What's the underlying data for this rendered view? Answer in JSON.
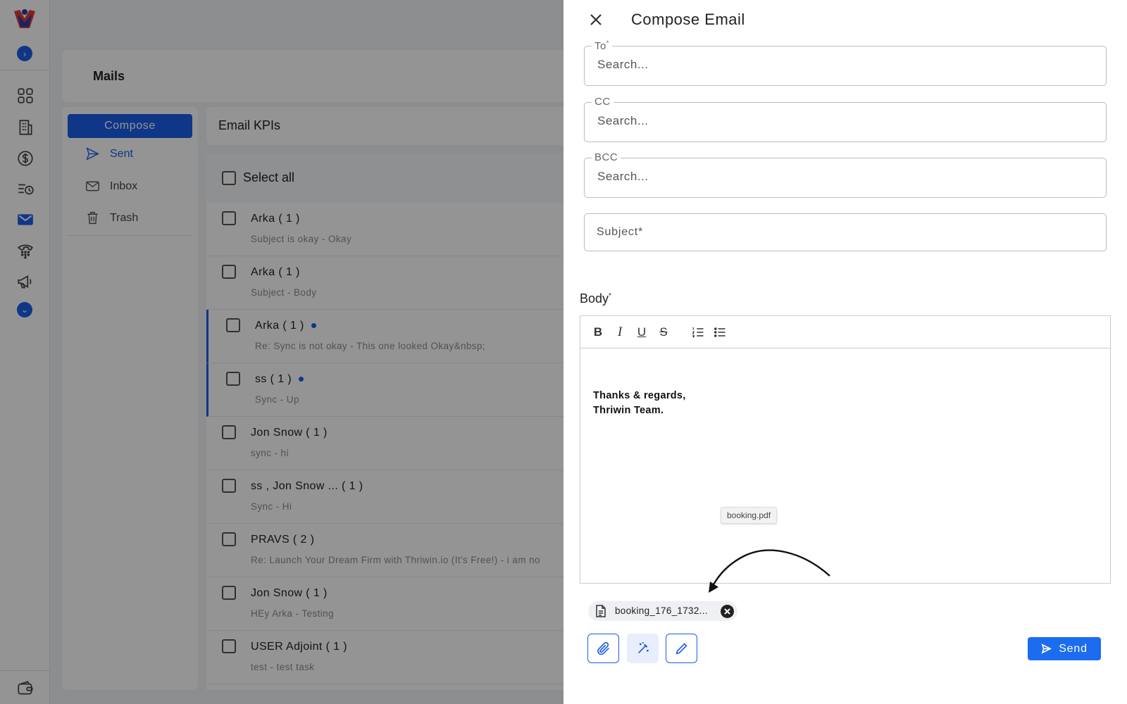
{
  "app": {
    "page_title": "Mails",
    "compose_label": "Compose",
    "nav": [
      {
        "label": "Sent",
        "icon": "send-icon",
        "active": true
      },
      {
        "label": "Inbox",
        "icon": "mail-icon",
        "active": false
      },
      {
        "label": "Trash",
        "icon": "trash-icon",
        "active": false
      }
    ],
    "kpi_title": "Email KPIs",
    "select_all": "Select all",
    "emails": [
      {
        "name": "Arka ( 1 )",
        "subject": "Subject is okay -  Okay",
        "unread": false
      },
      {
        "name": "Arka ( 1 )",
        "subject": "Subject -  Body",
        "unread": false
      },
      {
        "name": "Arka ( 1 )",
        "subject": "Re: Sync is not okay -  This one looked Okay&nbsp;",
        "unread": true
      },
      {
        "name": "ss ( 1 )",
        "subject": "Sync -  Up",
        "unread": true
      },
      {
        "name": "Jon Snow ( 1 )",
        "subject": "sync -  hi",
        "unread": false
      },
      {
        "name": "ss ,   Jon Snow ... ( 1 )",
        "subject": "Sync -  Hi",
        "unread": false
      },
      {
        "name": "PRAVS ( 2 )",
        "subject": "Re: Launch Your Dream Firm with Thriwin.io (It's Free!) -  i am no",
        "unread": false
      },
      {
        "name": "Jon Snow ( 1 )",
        "subject": "HEy Arka -  Testing",
        "unread": false
      },
      {
        "name": "USER Adjoint ( 1 )",
        "subject": "test -  test task",
        "unread": false
      }
    ]
  },
  "compose": {
    "title": "Compose Email",
    "to_label": "To",
    "cc_label": "CC",
    "bcc_label": "BCC",
    "search_placeholder": "Search...",
    "subject_placeholder": "Subject",
    "body_label": "Body",
    "required_mark": "*",
    "signature_line1": "Thanks & regards,",
    "signature_line2": "Thriwin Team.",
    "drag_tooltip": "booking.pdf",
    "attachment_name": "booking_176_1732...",
    "send_label": "Send"
  },
  "colors": {
    "accent": "#1c5ee8",
    "send": "#1c6cf0",
    "unread_dot": "#1c5ee8"
  }
}
